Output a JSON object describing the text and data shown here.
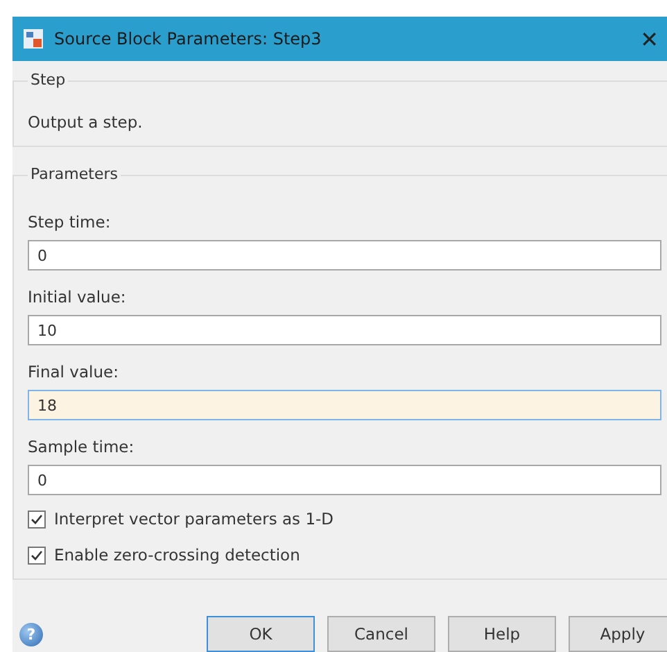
{
  "window": {
    "title": "Source Block Parameters: Step3",
    "close": "✕"
  },
  "description_group": {
    "title": "Step",
    "text": "Output a step."
  },
  "parameters_group": {
    "title": "Parameters",
    "fields": [
      {
        "label": "Step time:",
        "value": "0",
        "focused": false
      },
      {
        "label": "Initial value:",
        "value": "10",
        "focused": false
      },
      {
        "label": "Final value:",
        "value": "18",
        "focused": true
      },
      {
        "label": "Sample time:",
        "value": "0",
        "focused": false
      }
    ],
    "checkboxes": [
      {
        "label": "Interpret vector parameters as 1-D",
        "checked": true
      },
      {
        "label": "Enable zero-crossing detection",
        "checked": true
      }
    ]
  },
  "help_icon": "?",
  "buttons": [
    {
      "label": "OK",
      "default": true
    },
    {
      "label": "Cancel",
      "default": false
    },
    {
      "label": "Help",
      "default": false
    },
    {
      "label": "Apply",
      "default": false
    }
  ]
}
